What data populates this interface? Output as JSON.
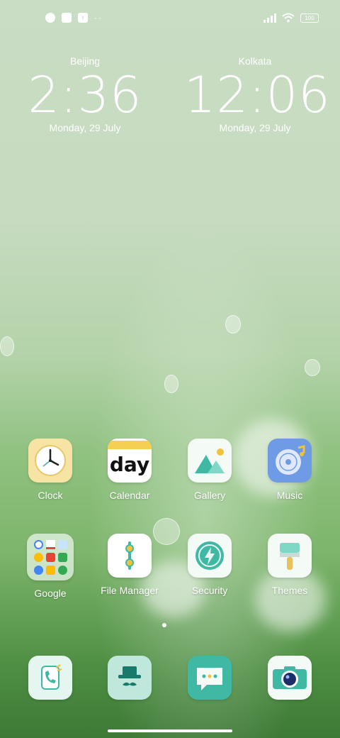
{
  "status_bar": {
    "left_icons": [
      "app-notification-icon",
      "square-notification-icon",
      "upload-notification-icon"
    ],
    "more_indicator": "··",
    "battery": "100"
  },
  "clocks": [
    {
      "city": "Beijing",
      "time": "2:36",
      "date": "Monday, 29 July"
    },
    {
      "city": "Kolkata",
      "time": "12:06",
      "date": "Monday, 29 July"
    }
  ],
  "apps_row1": [
    {
      "label": "Clock",
      "icon": "clock-icon"
    },
    {
      "label": "Calendar",
      "icon": "calendar-icon",
      "icon_text": "day"
    },
    {
      "label": "Gallery",
      "icon": "gallery-icon"
    },
    {
      "label": "Music",
      "icon": "music-icon"
    }
  ],
  "apps_row2": [
    {
      "label": "Google",
      "icon": "google-folder-icon"
    },
    {
      "label": "File Manager",
      "icon": "file-manager-icon"
    },
    {
      "label": "Security",
      "icon": "security-icon"
    },
    {
      "label": "Themes",
      "icon": "themes-icon"
    }
  ],
  "dock": [
    {
      "icon": "phone-icon"
    },
    {
      "icon": "contacts-icon"
    },
    {
      "icon": "messages-icon"
    },
    {
      "icon": "camera-icon"
    }
  ],
  "colors": {
    "accent_teal": "#3fb9a4",
    "icon_bg": "#f4faf6"
  }
}
